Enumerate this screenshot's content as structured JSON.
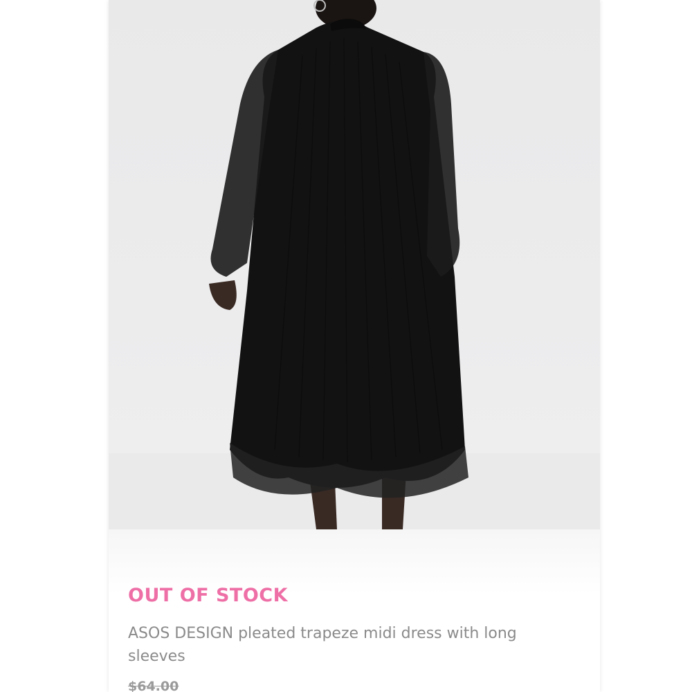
{
  "product": {
    "image_alt": "Back view of a model wearing a black sheer pleated midi dress with long sleeves",
    "stock_status": "OUT OF STOCK",
    "name": "ASOS DESIGN pleated trapeze midi dress with long sleeves",
    "price": "$64.00"
  },
  "colors": {
    "stock_status": "#ee6fa6",
    "name_text": "#8a8a8a",
    "price_text": "#9a9a9a",
    "photo_background": "#ececed",
    "dress": "#111111"
  }
}
